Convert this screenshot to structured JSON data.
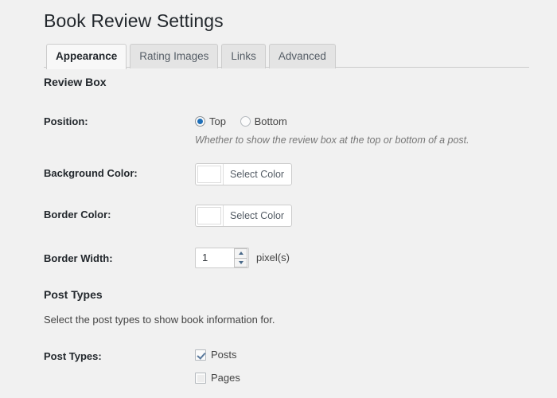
{
  "page_title": "Book Review Settings",
  "tabs": [
    {
      "label": "Appearance",
      "active": true
    },
    {
      "label": "Rating Images",
      "active": false
    },
    {
      "label": "Links",
      "active": false
    },
    {
      "label": "Advanced",
      "active": false
    }
  ],
  "sections": {
    "review_box": {
      "heading": "Review Box",
      "position": {
        "label": "Position:",
        "options": [
          {
            "label": "Top",
            "selected": true
          },
          {
            "label": "Bottom",
            "selected": false
          }
        ],
        "description": "Whether to show the review box at the top or bottom of a post."
      },
      "background_color": {
        "label": "Background Color:",
        "button_label": "Select Color",
        "swatch_color": "#ffffff"
      },
      "border_color": {
        "label": "Border Color:",
        "button_label": "Select Color",
        "swatch_color": "#ffffff"
      },
      "border_width": {
        "label": "Border Width:",
        "value": "1",
        "unit": "pixel(s)"
      }
    },
    "post_types": {
      "heading": "Post Types",
      "description": "Select the post types to show book information for.",
      "label": "Post Types:",
      "options": [
        {
          "label": "Posts",
          "checked": true
        },
        {
          "label": "Pages",
          "checked": false
        }
      ]
    }
  },
  "colors": {
    "page_background": "#f1f1f1",
    "accent": "#1e6fb8",
    "heading_text": "#23282d",
    "body_text": "#444444",
    "muted_text": "#777777",
    "border": "#cccccc"
  }
}
